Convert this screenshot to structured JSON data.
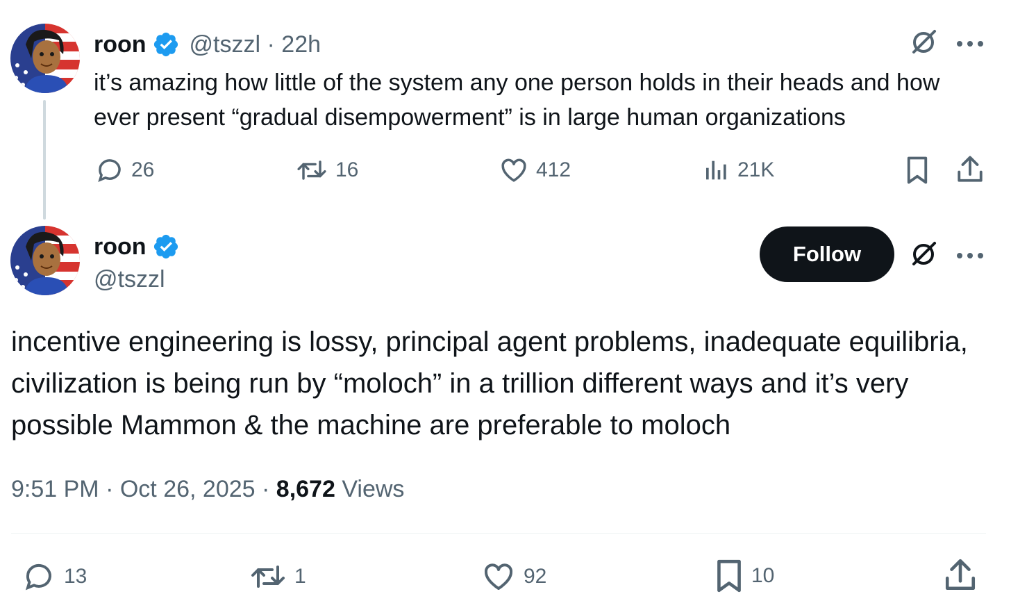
{
  "reply": {
    "author": {
      "name": "roon",
      "handle": "@tszzl",
      "separator": "·",
      "time": "22h"
    },
    "text": "it’s amazing how little of the system any one person holds in their heads and how ever present “gradual disempowerment” is in large human organizations",
    "actions": {
      "replies": "26",
      "reposts": "16",
      "likes": "412",
      "views": "21K"
    }
  },
  "main": {
    "author": {
      "name": "roon",
      "handle": "@tszzl"
    },
    "follow_label": "Follow",
    "text": "incentive engineering is lossy, principal agent problems, inadequate equilibria, civilization is being run by “moloch” in a trillion different ways and it’s very possible Mammon & the machine are preferable to moloch",
    "meta": {
      "time": "9:51 PM",
      "separator": "·",
      "date": "Oct 26, 2025",
      "separator2": "·",
      "views_count": "8,672",
      "views_label": "Views"
    },
    "actions": {
      "replies": "13",
      "reposts": "1",
      "likes": "92",
      "bookmarks": "10"
    }
  },
  "icons": {
    "verified": "verified-badge-icon",
    "grok": "grok-icon",
    "more": "more-icon",
    "reply": "reply-icon",
    "repost": "repost-icon",
    "like": "like-icon",
    "views": "views-icon",
    "bookmark": "bookmark-icon",
    "share": "share-icon"
  },
  "colors": {
    "text": "#0f1419",
    "muted": "#536471",
    "verified": "#1d9bf0",
    "follow_bg": "#0f1419",
    "thread_line": "#cfd9de"
  }
}
